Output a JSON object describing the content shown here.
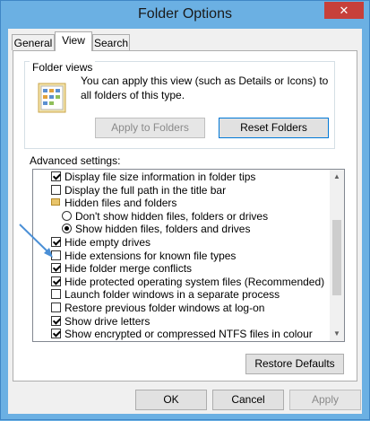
{
  "window": {
    "title": "Folder Options",
    "close_glyph": "✕"
  },
  "tabs": [
    {
      "label": "General",
      "active": false
    },
    {
      "label": "View",
      "active": true
    },
    {
      "label": "Search",
      "active": false
    }
  ],
  "folder_views": {
    "legend": "Folder views",
    "description": "You can apply this view (such as Details or Icons) to all folders of this type.",
    "apply_label": "Apply to Folders",
    "reset_label": "Reset Folders"
  },
  "advanced": {
    "label": "Advanced settings:",
    "items": [
      {
        "type": "checkbox",
        "checked": true,
        "indent": 0,
        "label": "Display file size information in folder tips"
      },
      {
        "type": "checkbox",
        "checked": false,
        "indent": 0,
        "label": "Display the full path in the title bar"
      },
      {
        "type": "folder",
        "checked": false,
        "indent": 0,
        "label": "Hidden files and folders"
      },
      {
        "type": "radio",
        "checked": false,
        "indent": 1,
        "label": "Don't show hidden files, folders or drives"
      },
      {
        "type": "radio",
        "checked": true,
        "indent": 1,
        "label": "Show hidden files, folders and drives"
      },
      {
        "type": "checkbox",
        "checked": true,
        "indent": 0,
        "label": "Hide empty drives"
      },
      {
        "type": "checkbox",
        "checked": false,
        "indent": 0,
        "label": "Hide extensions for known file types"
      },
      {
        "type": "checkbox",
        "checked": true,
        "indent": 0,
        "label": "Hide folder merge conflicts"
      },
      {
        "type": "checkbox",
        "checked": true,
        "indent": 0,
        "label": "Hide protected operating system files (Recommended)"
      },
      {
        "type": "checkbox",
        "checked": false,
        "indent": 0,
        "label": "Launch folder windows in a separate process"
      },
      {
        "type": "checkbox",
        "checked": false,
        "indent": 0,
        "label": "Restore previous folder windows at log-on"
      },
      {
        "type": "checkbox",
        "checked": true,
        "indent": 0,
        "label": "Show drive letters"
      },
      {
        "type": "checkbox",
        "checked": true,
        "indent": 0,
        "label": "Show encrypted or compressed NTFS files in colour"
      }
    ],
    "restore_label": "Restore Defaults"
  },
  "footer": {
    "ok_label": "OK",
    "cancel_label": "Cancel",
    "apply_label": "Apply"
  },
  "colors": {
    "frame": "#6bb0e3",
    "close": "#c7403a",
    "annotation_arrow": "#4a8fd6"
  }
}
